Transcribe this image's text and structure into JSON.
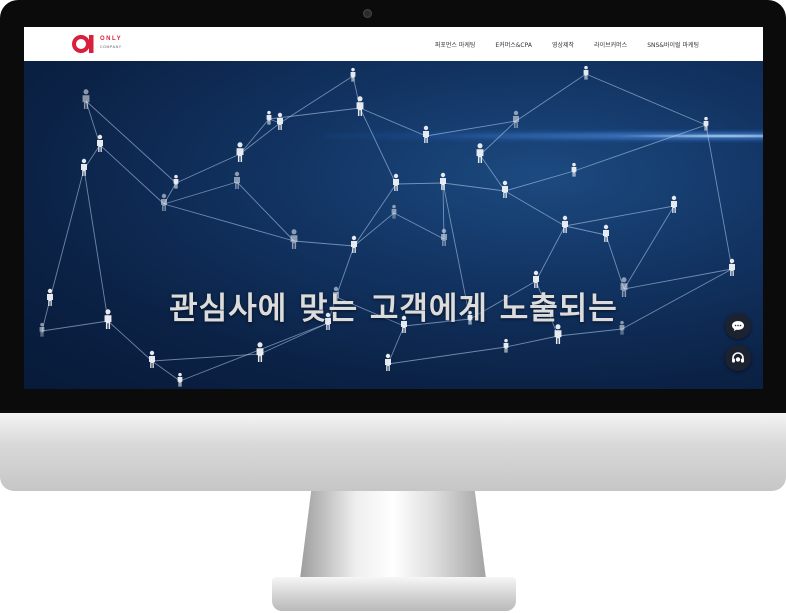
{
  "header": {
    "logo": {
      "name": "ONLY",
      "sub": "COMPANY"
    },
    "nav": [
      {
        "label": "퍼포먼스 마케팅"
      },
      {
        "label": "E커머스&CPA"
      },
      {
        "label": "영상제작"
      },
      {
        "label": "라이브커머스"
      },
      {
        "label": "SNS&바이럴 마케팅"
      }
    ]
  },
  "hero": {
    "headline": "관심사에 맞는 고객에게 노출되는"
  },
  "floating": {
    "chat_icon": "speech-bubble-icon",
    "counsel_icon": "headset-icon"
  },
  "colors": {
    "brand": "#d91f3c",
    "hero_bg": "#0d2547",
    "headline": "#dcdcdc"
  }
}
